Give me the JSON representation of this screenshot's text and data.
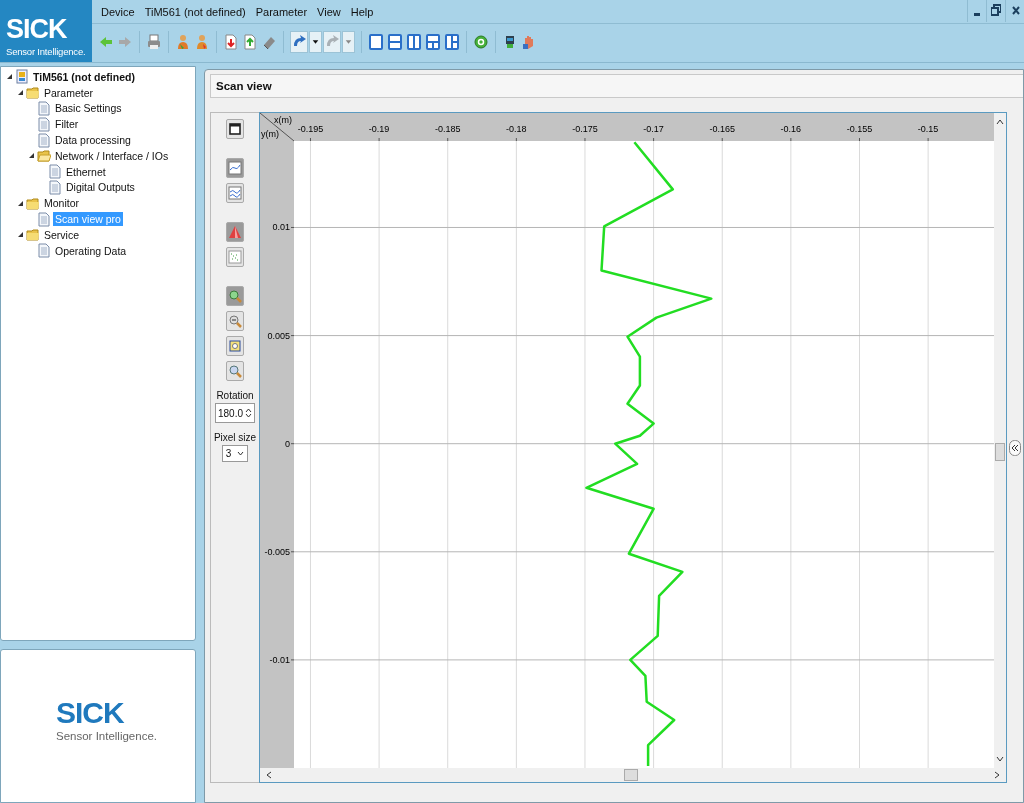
{
  "header": {
    "logo": {
      "wordmark": "SICK",
      "tagline": "Sensor Intelligence."
    },
    "menu": [
      "Device",
      "TiM561 (not defined)",
      "Parameter",
      "View",
      "Help"
    ]
  },
  "tree": [
    {
      "label": "TiM561 (not defined)",
      "kind": "device",
      "expanded": true,
      "selected": false,
      "children": [
        {
          "label": "Parameter",
          "kind": "folder",
          "expanded": true,
          "selected": false,
          "children": [
            {
              "label": "Basic Settings",
              "kind": "page",
              "selected": false
            },
            {
              "label": "Filter",
              "kind": "page",
              "selected": false
            },
            {
              "label": "Data processing",
              "kind": "page",
              "selected": false
            },
            {
              "label": "Network / Interface / IOs",
              "kind": "folder-open",
              "expanded": true,
              "selected": false,
              "children": [
                {
                  "label": "Ethernet",
                  "kind": "page",
                  "selected": false
                },
                {
                  "label": "Digital Outputs",
                  "kind": "page",
                  "selected": false
                }
              ]
            }
          ]
        },
        {
          "label": "Monitor",
          "kind": "folder",
          "expanded": true,
          "selected": false,
          "children": [
            {
              "label": "Scan view pro",
              "kind": "page",
              "selected": true
            }
          ]
        },
        {
          "label": "Service",
          "kind": "folder",
          "expanded": true,
          "selected": false,
          "children": [
            {
              "label": "Operating Data",
              "kind": "page",
              "selected": false
            }
          ]
        }
      ]
    }
  ],
  "logo_panel": {
    "wordmark": "SICK",
    "tagline": "Sensor Intelligence."
  },
  "scan_view": {
    "title": "Scan view",
    "rotation": {
      "label": "Rotation",
      "value": "180.0"
    },
    "pixel_size": {
      "label": "Pixel size",
      "value": "3"
    },
    "chart_data": {
      "type": "line",
      "xlabel": "x(m)",
      "ylabel": "y(m)",
      "x": [
        -0.1714,
        -0.1686,
        -0.1736,
        -0.1738,
        -0.1658,
        -0.1698,
        -0.1719,
        -0.171,
        -0.171,
        -0.1719,
        -0.17,
        -0.171,
        -0.1728,
        -0.1712,
        -0.1749,
        -0.17,
        -0.1718,
        -0.1679,
        -0.1696,
        -0.1697,
        -0.1717,
        -0.1706,
        -0.1705,
        -0.1685,
        -0.1704,
        -0.1704
      ],
      "series": [
        {
          "color": "#22dd22",
          "values": [
            0.01394,
            0.01176,
            0.01005,
            0.00801,
            0.00671,
            0.00583,
            0.00495,
            0.00403,
            0.00269,
            0.00185,
            0.00093,
            0.00037,
            0,
            -0.00093,
            -0.00204,
            -0.00301,
            -0.00509,
            -0.00593,
            -0.00704,
            -0.00889,
            -0.01,
            -0.01074,
            -0.01194,
            -0.01278,
            -0.01394,
            -0.01491
          ]
        }
      ],
      "grid": true,
      "xlim": [
        -0.1962,
        -0.1452
      ],
      "ylim": [
        -0.015,
        0.014
      ],
      "xticks": [
        -0.195,
        -0.19,
        -0.185,
        -0.18,
        -0.175,
        -0.17,
        -0.165,
        -0.16,
        -0.155,
        -0.15
      ],
      "yticks": [
        0.01,
        0.005,
        0,
        -0.005,
        -0.01
      ]
    }
  }
}
